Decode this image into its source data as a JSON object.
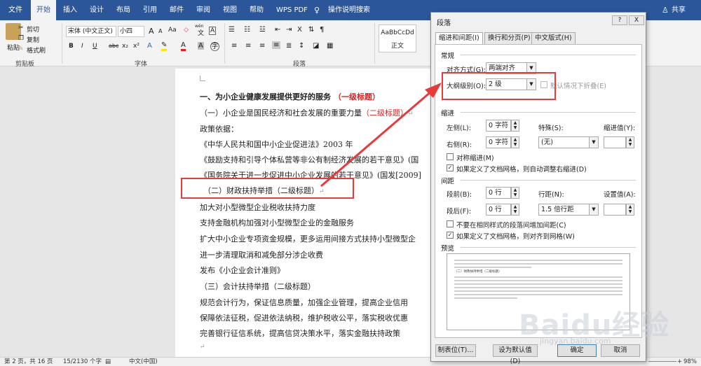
{
  "tabs": [
    "文件",
    "开始",
    "插入",
    "设计",
    "布局",
    "引用",
    "邮件",
    "审阅",
    "视图",
    "帮助",
    "WPS PDF",
    "操作说明搜索"
  ],
  "share": "共享",
  "ribbon": {
    "paste": "粘贴",
    "cut": "剪切",
    "copy": "复制",
    "format_painter": "格式刷",
    "clipboard": "剪贴板",
    "font_name": "宋体 (中文正文)",
    "font_size": "小四",
    "grow": "A",
    "shrink": "A",
    "aa": "Aa",
    "wen": "wén",
    "bold": "B",
    "italic": "I",
    "underline": "U",
    "strike": "abc",
    "sub": "x₂",
    "sup": "x²",
    "font_label": "字体",
    "paragraph_label": "段落",
    "style_sample": "AaBbCcDd",
    "style_name": "正文"
  },
  "doc": {
    "h1": "一、为小企业健康发展提供更好的服务",
    "h1_note": "（一级标题）",
    "h2a": "（一）小企业是国民经济和社会发展的重要力量",
    "h2a_note": "（二级标题）",
    "l3": "政策依据：",
    "l4": "《中华人民共和国中小企业促进法》2003 年",
    "l5": "《鼓励支持和引导个体私营等非公有制经济发展的若干意见》(国",
    "l6": "《国务院关于进一步促进中小企业发展的若干意见》(国发[2009]",
    "h2b": "（二）财政扶持举措（二级标题）",
    "l8": "加大对小型微型企业税收扶持力度",
    "l9": "支持金融机构加强对小型微型企业的金融服务",
    "l10": "扩大中小企业专项资金规模，更多运用间接方式扶持小型微型企",
    "l11": "进一步清理取消和减免部分涉企收费",
    "l12": "发布《小企业会计准则》",
    "h2c": "（三）会计扶持举措（二级标题）",
    "l14": "规范会计行为，保证信息质量，加强企业管理，提高企业信用",
    "l15": "保障依法征税，促进依法纳税，维护税收公平，落实税收优惠",
    "l16": "完善银行征信系统，提高信贷决策水平，落实金融扶持政策",
    "para_mark": "↵"
  },
  "status": {
    "page": "第 2 页，共 16 页",
    "words": "15/2130 个字",
    "lang": "中文(中国)",
    "zoom": "98%"
  },
  "dialog": {
    "title": "段落",
    "help": "?",
    "close": "X",
    "tabs": [
      "缩进和间距(I)",
      "换行和分页(P)",
      "中文版式(H)"
    ],
    "general": "常规",
    "align_label": "对齐方式(G):",
    "align_value": "两端对齐",
    "outline_label": "大纲级别(O):",
    "outline_value": "2 级",
    "collapse": "默认情况下折叠(E)",
    "indent": "缩进",
    "left_label": "左侧(L):",
    "left_value": "0 字符",
    "right_label": "右侧(R):",
    "right_value": "0 字符",
    "special_label": "特殊(S):",
    "special_value": "(无)",
    "indent_by_label": "缩进值(Y):",
    "mirror": "对称缩进(M)",
    "auto_right": "如果定义了文档网格，则自动调整右缩进(D)",
    "spacing": "间距",
    "before_label": "段前(B):",
    "before_value": "0 行",
    "after_label": "段后(F):",
    "after_value": "0 行",
    "line_label": "行距(N):",
    "line_value": "1.5 倍行距",
    "at_label": "设置值(A):",
    "no_space": "不要在相同样式的段落间增加间距(C)",
    "snap_grid": "如果定义了文档网格，则对齐到网格(W)",
    "preview": "预览",
    "preview_text": "（二）财政扶持举措（二级标题）",
    "tabs_btn": "制表位(T)...",
    "default_btn": "设为默认值(D)",
    "ok_btn": "确定",
    "cancel_btn": "取消"
  },
  "watermark": "Baidu经验",
  "watermark_url": "jingyan.baidu.com",
  "colors": {
    "ribbon_blue": "#2b579a",
    "annotation_red": "#e83a3a"
  }
}
